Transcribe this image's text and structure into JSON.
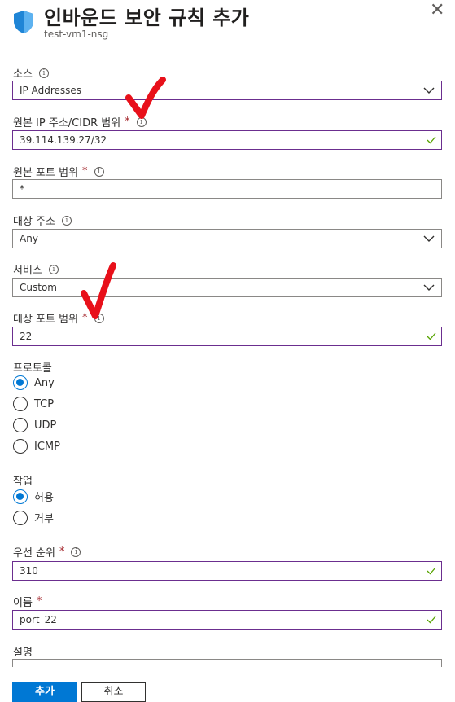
{
  "header": {
    "title": "인바운드 보안 규칙 추가",
    "subtitle": "test-vm1-nsg",
    "close_glyph": "✕"
  },
  "fields": {
    "source": {
      "label": "소스",
      "value": "IP Addresses"
    },
    "source_ip": {
      "label": "원본 IP 주소/CIDR 범위",
      "required_mark": "*",
      "value": "39.114.139.27/32"
    },
    "source_port": {
      "label": "원본 포트 범위",
      "required_mark": "*",
      "value": "*"
    },
    "destination": {
      "label": "대상 주소",
      "value": "Any"
    },
    "service": {
      "label": "서비스",
      "value": "Custom"
    },
    "dest_port": {
      "label": "대상 포트 범위",
      "required_mark": "*",
      "value": "22"
    },
    "protocol": {
      "label": "프로토콜",
      "options": [
        "Any",
        "TCP",
        "UDP",
        "ICMP"
      ],
      "selected": "Any"
    },
    "action": {
      "label": "작업",
      "options": [
        "허용",
        "거부"
      ],
      "selected": "허용"
    },
    "priority": {
      "label": "우선 순위",
      "required_mark": "*",
      "value": "310"
    },
    "name": {
      "label": "이름",
      "required_mark": "*",
      "value": "port_22"
    },
    "description": {
      "label": "설명",
      "value": ""
    }
  },
  "buttons": {
    "add": "추가",
    "cancel": "취소"
  },
  "colors": {
    "accent": "#0078d4",
    "valid_border": "#6b2e8f",
    "required": "#a4262c",
    "annotation": "#e8101a",
    "check": "#57a300"
  },
  "info_glyph": "i"
}
